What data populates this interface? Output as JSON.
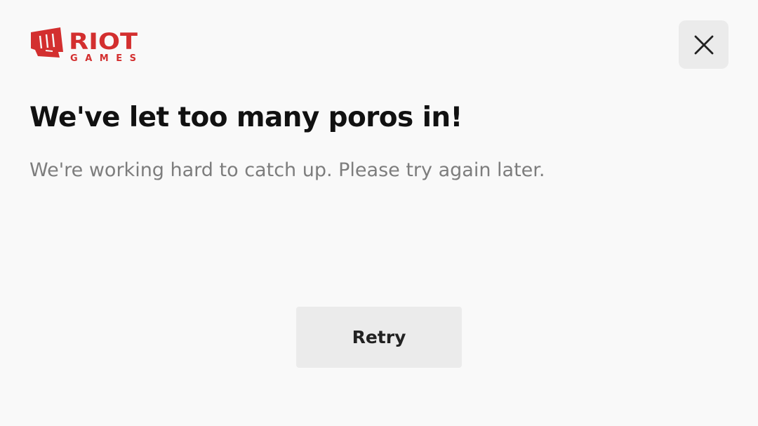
{
  "brand": {
    "logo_name": "riot-games-logo",
    "word_top": "RIOT",
    "word_bottom": "GAMES",
    "color": "#d32f2f"
  },
  "header": {
    "close_icon": "close-icon"
  },
  "main": {
    "title": "We've let too many poros in!",
    "message": "We're working hard to catch up. Please try again later.",
    "retry_label": "Retry"
  }
}
